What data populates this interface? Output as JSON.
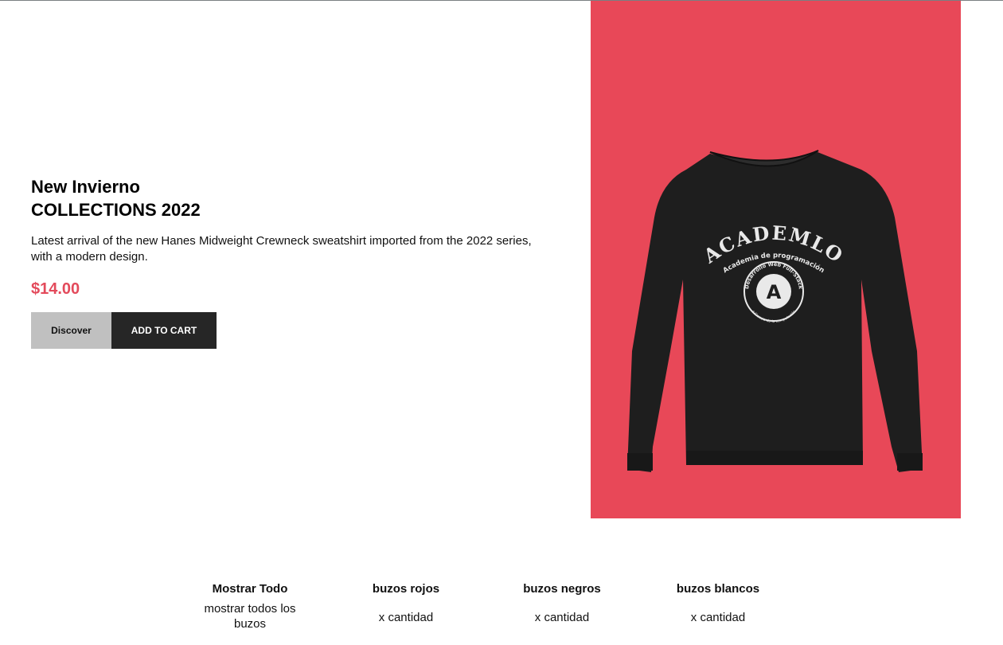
{
  "hero": {
    "title_line1": "New Invierno",
    "title_line2": "COLLECTIONS 2022",
    "description": "Latest arrival of the new Hanes Midweight Crewneck sweatshirt imported from the 2022 series, with a modern design.",
    "price": "$14.00",
    "discover_label": "Discover",
    "add_to_cart_label": "ADD TO CART"
  },
  "product_image": {
    "background_color": "#e84858",
    "sweatshirt_color": "#1e1e1e",
    "print_main": "ACADEMLO",
    "print_sub": "Academia de programación",
    "badge_ring": "Desarrollo Web Full-Stack",
    "badge_bottom": "a Ciencia de la computación",
    "badge_logo": "A"
  },
  "filters": [
    {
      "title": "Mostrar Todo",
      "subtitle": "mostrar todos los buzos"
    },
    {
      "title": "buzos rojos",
      "subtitle": "x cantidad"
    },
    {
      "title": "buzos negros",
      "subtitle": "x cantidad"
    },
    {
      "title": "buzos blancos",
      "subtitle": "x cantidad"
    }
  ]
}
